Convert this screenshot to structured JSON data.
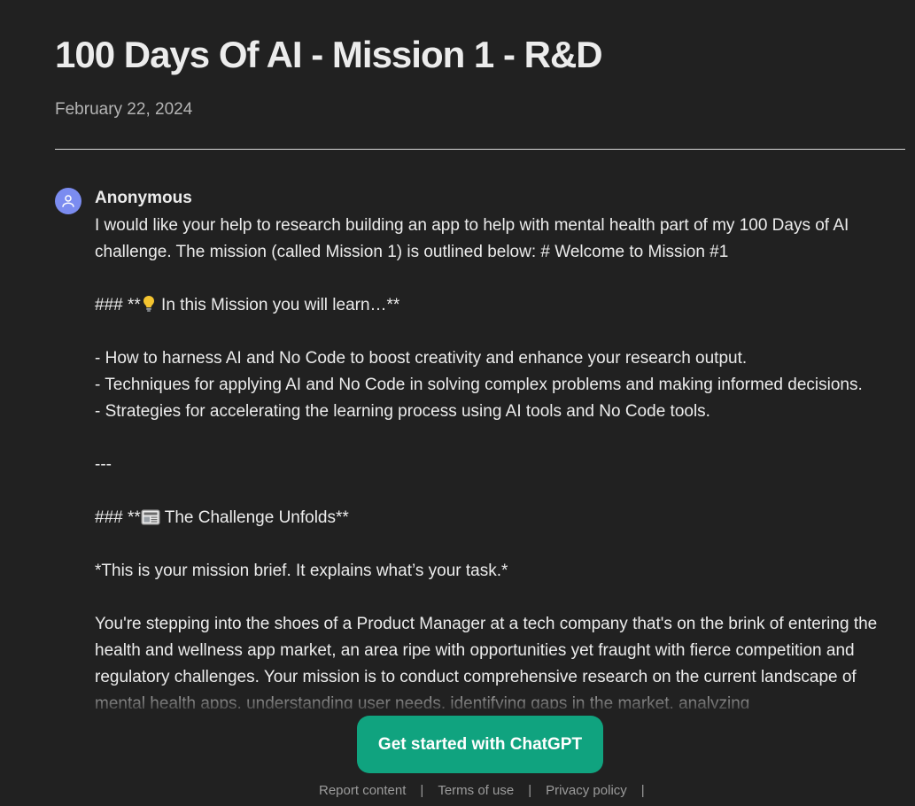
{
  "header": {
    "title": "100 Days Of AI - Mission 1 - R&D",
    "date": "February 22, 2024"
  },
  "message": {
    "author": "Anonymous",
    "avatar_icon": "user-icon",
    "avatar_color": "#7b8cf0",
    "line1": "I would like your help to research building an app to help with mental health part of my 100 Days of AI challenge. The mission (called Mission 1) is outlined below: # Welcome to Mission #1",
    "learn_prefix": "### **",
    "learn_icon": "lightbulb-icon",
    "learn_text": " In this Mission you will learn…**",
    "bullet1": "- How to harness AI and No Code to boost creativity and enhance your research output.",
    "bullet2": "- Techniques for applying AI and No Code in solving complex problems and making informed decisions.",
    "bullet3": "- Strategies for accelerating the learning process using AI tools and No Code tools.",
    "rule": "---",
    "challenge_prefix": "### **",
    "challenge_icon": "newspaper-icon",
    "challenge_text": " The Challenge Unfolds**",
    "brief": "*This is your mission brief. It explains what’s your task.*",
    "paragraph": "You're stepping into the shoes of a Product Manager at a tech company that's on the brink of entering the health and wellness app market, an area ripe with opportunities yet fraught with fierce competition and regulatory challenges. Your mission is to conduct comprehensive research on the current landscape of mental health apps, understanding user needs, identifying gaps in the market, analyzing"
  },
  "cta": {
    "label": "Get started with ChatGPT",
    "color": "#10a37f"
  },
  "footer": {
    "report": "Report content",
    "terms": "Terms of use",
    "privacy": "Privacy policy",
    "separator": "|"
  }
}
